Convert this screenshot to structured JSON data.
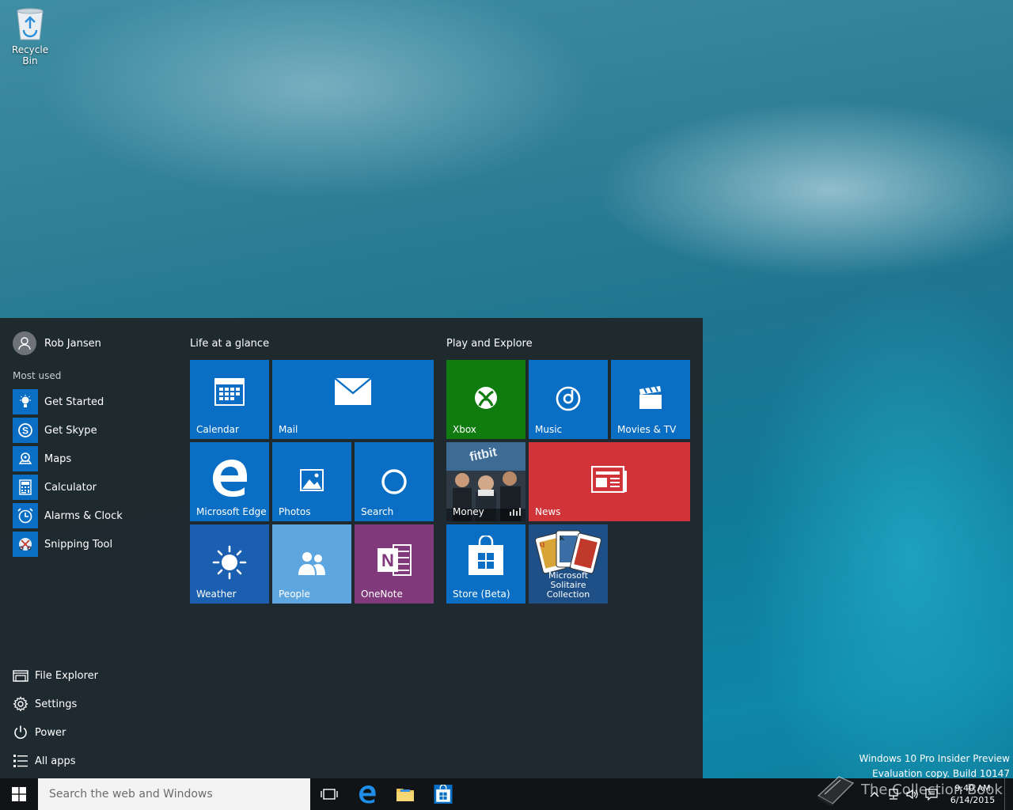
{
  "desktop": {
    "recycle_bin_label": "Recycle Bin"
  },
  "start": {
    "user_name": "Rob Jansen",
    "most_used_title": "Most used",
    "most_used": [
      {
        "label": "Get Started",
        "icon": "lightbulb-icon"
      },
      {
        "label": "Get Skype",
        "icon": "skype-icon"
      },
      {
        "label": "Maps",
        "icon": "maps-icon"
      },
      {
        "label": "Calculator",
        "icon": "calculator-icon"
      },
      {
        "label": "Alarms & Clock",
        "icon": "alarm-clock-icon"
      },
      {
        "label": "Snipping Tool",
        "icon": "scissors-icon"
      }
    ],
    "bottom": [
      {
        "label": "File Explorer",
        "icon": "file-explorer-icon"
      },
      {
        "label": "Settings",
        "icon": "gear-icon"
      },
      {
        "label": "Power",
        "icon": "power-icon"
      },
      {
        "label": "All apps",
        "icon": "list-icon"
      }
    ],
    "groups": {
      "life": "Life at a glance",
      "play": "Play and Explore"
    },
    "tiles": {
      "calendar": "Calendar",
      "mail": "Mail",
      "edge": "Microsoft Edge",
      "photos": "Photos",
      "search": "Search",
      "weather": "Weather",
      "people": "People",
      "onenote": "OneNote",
      "xbox": "Xbox",
      "music": "Music",
      "movies": "Movies & TV",
      "money": "Money",
      "news": "News",
      "store": "Store (Beta)",
      "solitaire_line1": "Microsoft",
      "solitaire_line2": "Solitaire Collection"
    },
    "colors": {
      "blue": "#0a6fc4",
      "xbox_green": "#107c10",
      "news_red": "#d13438",
      "people_light": "#5ea6e0",
      "onenote_purple": "#80397b",
      "weather_blue": "#1a5fb0"
    }
  },
  "watermark": {
    "line1": "Windows 10 Pro Insider Preview",
    "line2": "Evaluation copy. Build 10147"
  },
  "taskbar": {
    "search_placeholder": "Search the web and Windows",
    "time": "9:40 AM",
    "date": "6/14/2015",
    "brand_overlay": "The Collection Book"
  }
}
